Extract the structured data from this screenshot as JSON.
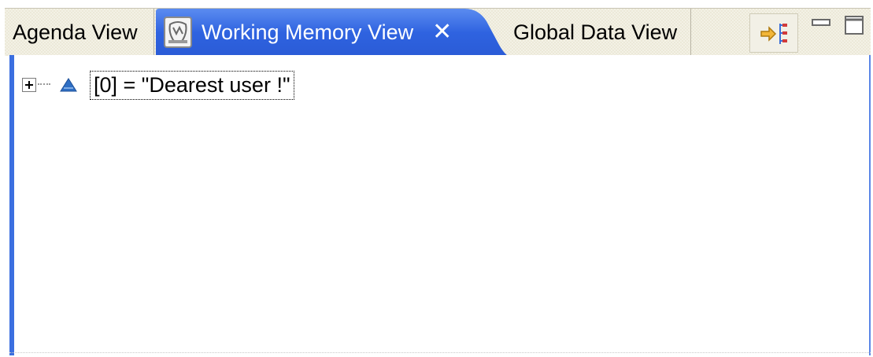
{
  "tabs": {
    "agenda": {
      "label": "Agenda View"
    },
    "working_memory": {
      "label": "Working Memory View",
      "close": "✕"
    },
    "global_data": {
      "label": "Global Data View"
    }
  },
  "tree": {
    "items": [
      {
        "label": "[0] = \"Dearest user !\"",
        "expanded": false
      }
    ]
  },
  "colors": {
    "active_tab": "#2f63e0",
    "active_tab_light": "#4f80ee",
    "tab_strip": "#ece9d8",
    "pane_border": "#3b6fe0"
  },
  "icons": {
    "working_memory_tab": "working-memory-icon",
    "toolbar": "show-logical-structure-icon",
    "minimize": "minimize-icon",
    "maximize": "maximize-icon",
    "tree_node": "variable-icon"
  }
}
